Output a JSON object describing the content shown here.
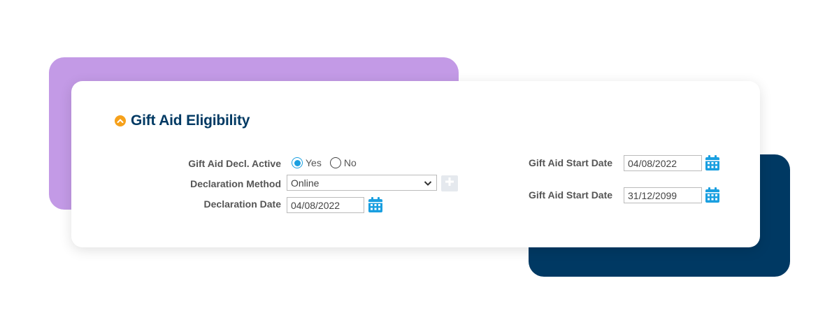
{
  "section": {
    "title": "Gift Aid Eligibility"
  },
  "fields": {
    "decl_active": {
      "label": "Gift Aid  Decl. Active",
      "options": [
        "Yes",
        "No"
      ],
      "selected": "Yes"
    },
    "declaration_method": {
      "label": "Declaration Method",
      "value": "Online"
    },
    "declaration_date": {
      "label": "Declaration Date",
      "value": "04/08/2022"
    },
    "start_date": {
      "label": "Gift Aid Start Date",
      "value": "04/08/2022"
    },
    "end_date": {
      "label": "Gift Aid Start Date",
      "value": "31/12/2099"
    }
  },
  "icons": {
    "collapse": "chevron-up-icon",
    "calendar": "calendar-icon",
    "add": "plus-icon",
    "dropdown": "chevron-down-icon"
  },
  "colors": {
    "brand_navy": "#003963",
    "accent_purple": "#c39ae6",
    "accent_orange": "#f6a11b",
    "accent_blue": "#1a9fe0"
  }
}
